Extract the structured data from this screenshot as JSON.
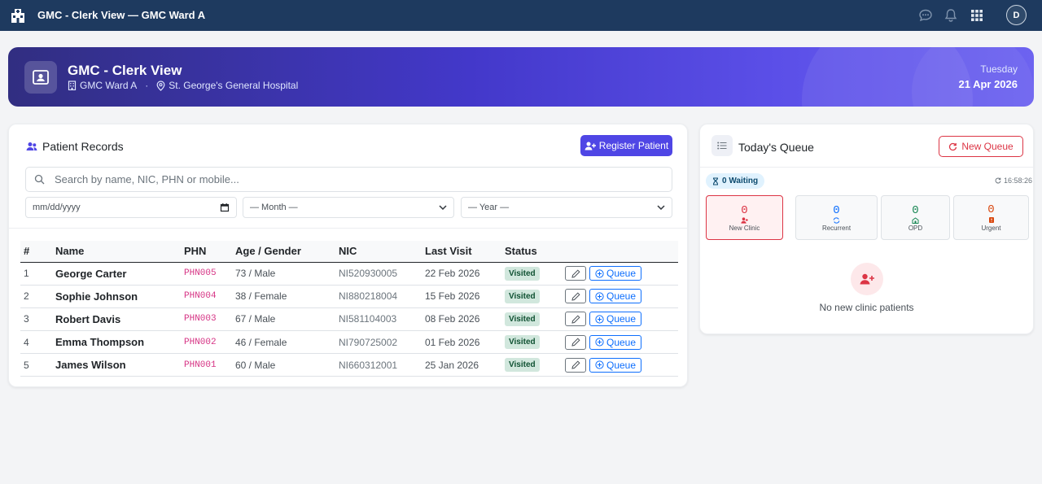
{
  "topbar": {
    "title": "GMC - Clerk View — GMC Ward A",
    "avatar_initial": "D",
    "icons": [
      "hospital-icon",
      "chat-icon",
      "bell-icon",
      "apps-grid-icon"
    ]
  },
  "hero": {
    "title": "GMC - Clerk View",
    "ward": "GMC Ward A",
    "separator": "·",
    "hospital": "St. George's General Hospital",
    "day": "Tuesday",
    "date": "21 Apr 2026"
  },
  "records": {
    "title": "Patient Records",
    "register_label": "Register Patient",
    "search_placeholder": "Search by name, NIC, PHN or mobile...",
    "date_placeholder": "mm/dd/yyyy",
    "month_label": "— Month —",
    "year_label": "— Year —",
    "columns": [
      "#",
      "Name",
      "PHN",
      "Age / Gender",
      "NIC",
      "Last Visit",
      "Status",
      ""
    ],
    "queue_label": "Queue",
    "rows": [
      {
        "n": "1",
        "name": "George Carter",
        "phn": "PHN005",
        "age": "73 / Male",
        "nic": "NI520930005",
        "last": "22 Feb 2026",
        "status": "Visited"
      },
      {
        "n": "2",
        "name": "Sophie Johnson",
        "phn": "PHN004",
        "age": "38 / Female",
        "nic": "NI880218004",
        "last": "15 Feb 2026",
        "status": "Visited"
      },
      {
        "n": "3",
        "name": "Robert Davis",
        "phn": "PHN003",
        "age": "67 / Male",
        "nic": "NI581104003",
        "last": "08 Feb 2026",
        "status": "Visited"
      },
      {
        "n": "4",
        "name": "Emma Thompson",
        "phn": "PHN002",
        "age": "46 / Female",
        "nic": "NI790725002",
        "last": "01 Feb 2026",
        "status": "Visited"
      },
      {
        "n": "5",
        "name": "James Wilson",
        "phn": "PHN001",
        "age": "60 / Male",
        "nic": "NI660312001",
        "last": "25 Jan 2026",
        "status": "Visited"
      }
    ]
  },
  "queue": {
    "title": "Today's Queue",
    "new_queue_label": "New Queue",
    "waiting": "0 Waiting",
    "time": "16:58:26",
    "stats": [
      {
        "value": "0",
        "label": "New Clinic",
        "color": "#dc3545"
      },
      {
        "value": "0",
        "label": "Recurrent",
        "color": "#0d6efd"
      },
      {
        "value": "0",
        "label": "OPD",
        "color": "#198754"
      },
      {
        "value": "0",
        "label": "Urgent",
        "color": "#d9480f"
      }
    ],
    "empty_text": "No new clinic patients"
  },
  "colors": {
    "topbar": "#1e3a5f",
    "accent": "#4f46e5",
    "danger": "#dc3545",
    "primary": "#0d6efd",
    "phn": "#d63384"
  }
}
